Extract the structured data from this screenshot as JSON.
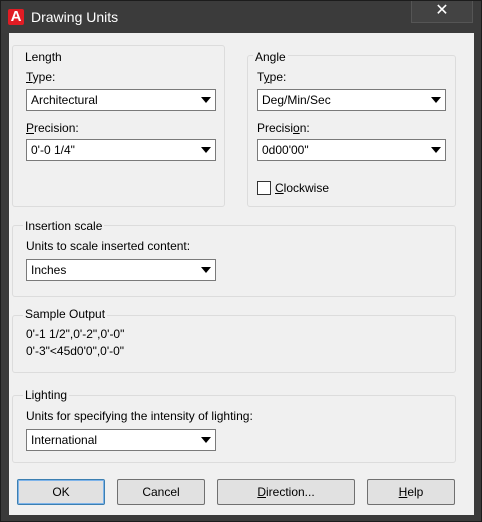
{
  "window": {
    "title": "Drawing Units",
    "app_icon_letter": "A",
    "close_glyph": "✕"
  },
  "length": {
    "group_label": "Length",
    "type_label_u": "T",
    "type_label_rest": "ype:",
    "type_value": "Architectural",
    "precision_label_u": "P",
    "precision_label_rest": "recision:",
    "precision_value": "0'-0 1/4\""
  },
  "angle": {
    "group_label": "Angle",
    "type_label_pre": "T",
    "type_label_u": "y",
    "type_label_rest": "pe:",
    "type_value": "Deg/Min/Sec",
    "precision_label_pre": "Precisi",
    "precision_label_u": "o",
    "precision_label_rest": "n:",
    "precision_value": "0d00'00\"",
    "clockwise_label_u": "C",
    "clockwise_label_rest": "lockwise",
    "clockwise_checked": false
  },
  "insertion": {
    "group_label": "Insertion scale",
    "units_label": "Units to scale inserted content:",
    "units_value": "Inches"
  },
  "sample": {
    "group_label": "Sample Output",
    "line1": "0'-1 1/2\",0'-2\",0'-0\"",
    "line2": "0'-3\"<45d0'0\",0'-0\""
  },
  "lighting": {
    "group_label": "Lighting",
    "units_label": "Units for specifying the intensity of lighting:",
    "units_value": "International"
  },
  "buttons": {
    "ok": "OK",
    "cancel": "Cancel",
    "direction_u": "D",
    "direction_rest": "irection...",
    "help_u": "H",
    "help_rest": "elp"
  },
  "colors": {
    "titlebar": "#3b3b3b",
    "client": "#f0f0f0",
    "app_icon": "#e11c24"
  }
}
